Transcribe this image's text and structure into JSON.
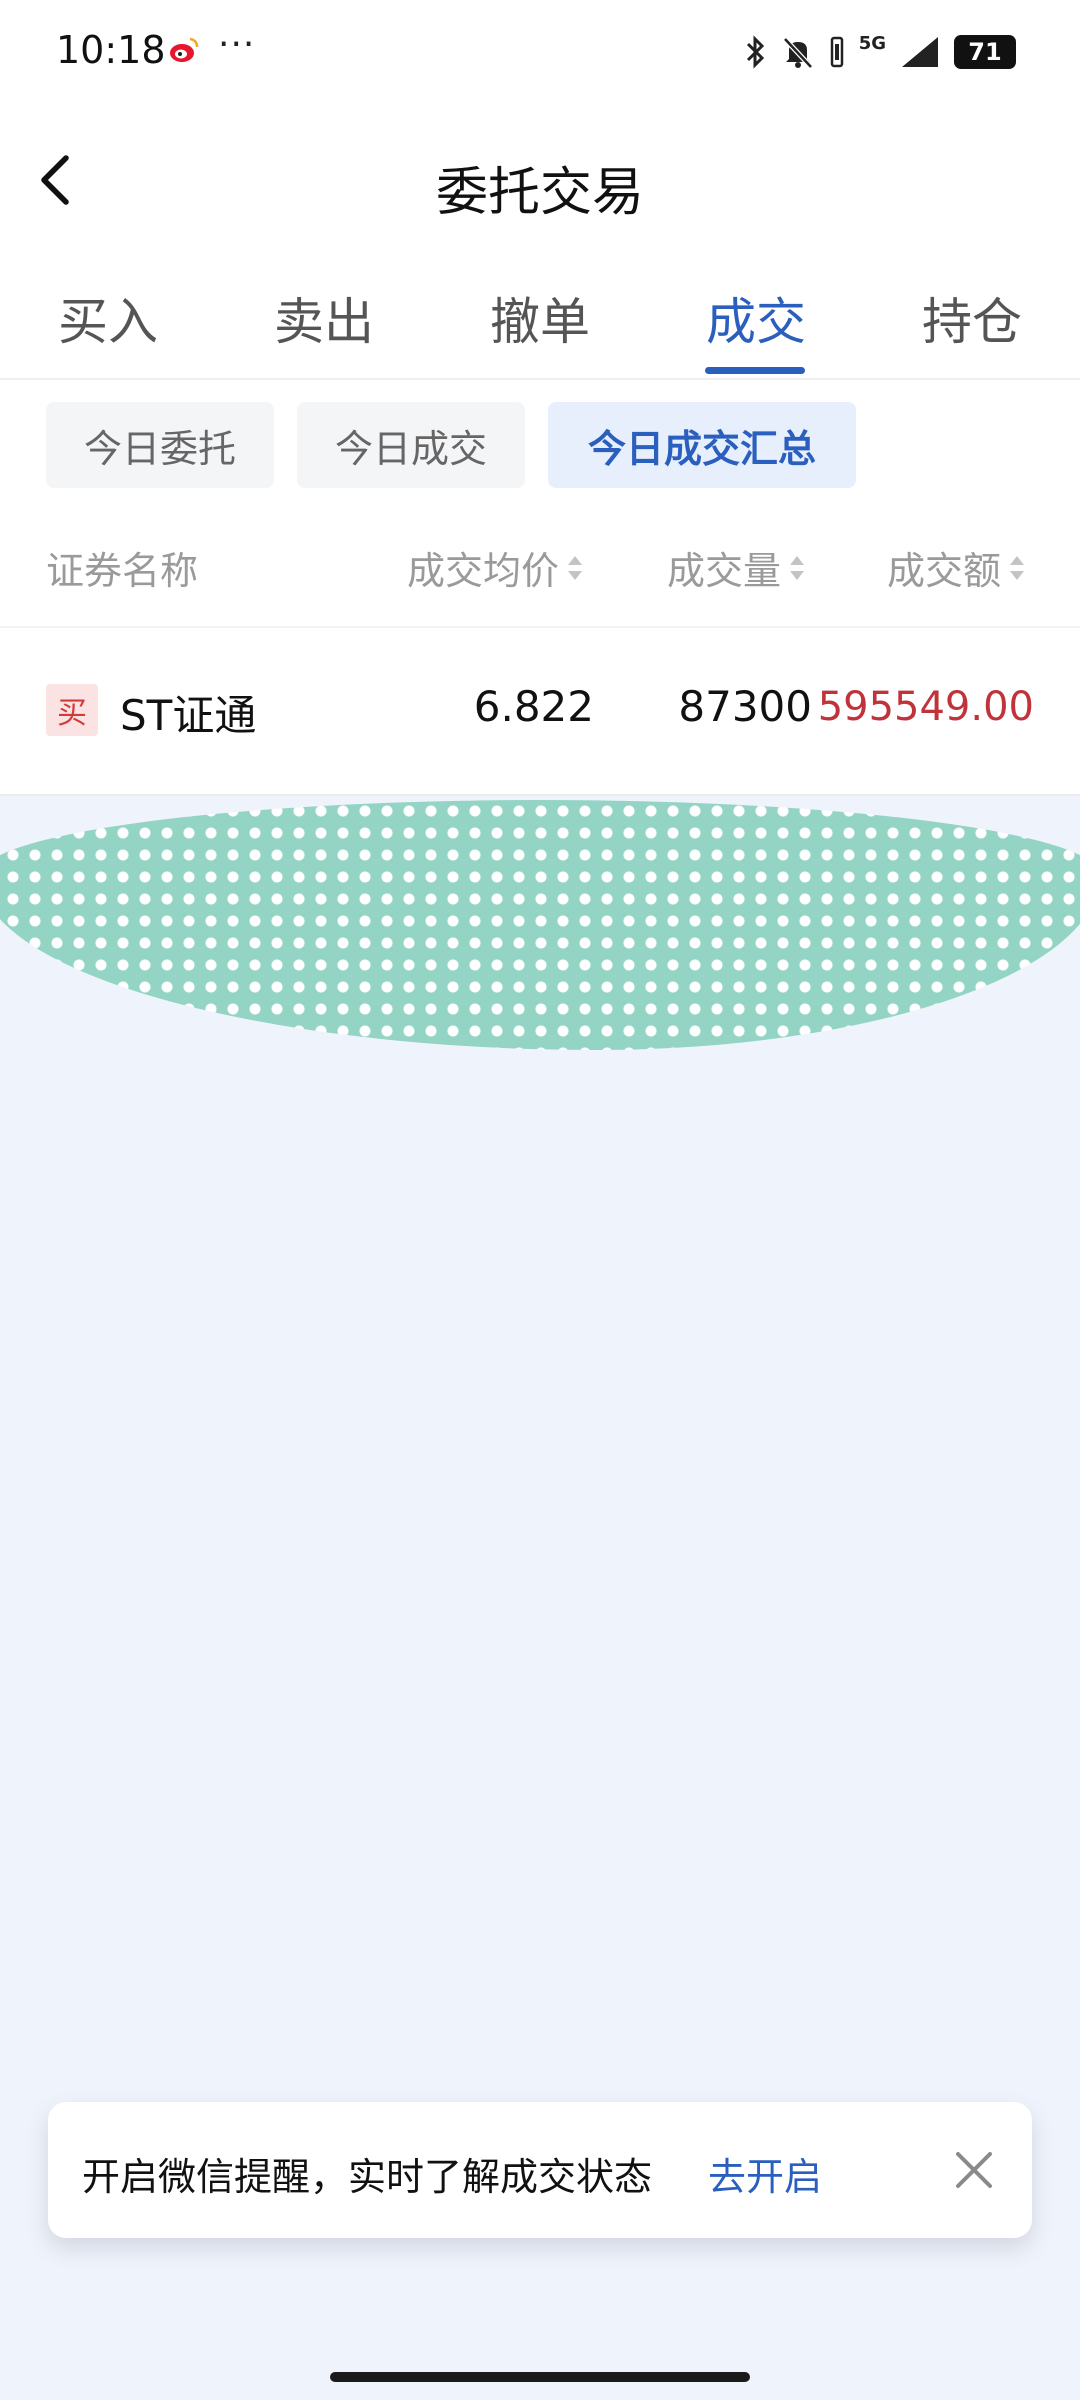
{
  "status_bar": {
    "time": "10:18",
    "more": "···",
    "network": "5G",
    "battery": "71",
    "icons": [
      "weibo-icon",
      "bluetooth-icon",
      "mute-icon",
      "vibrate-icon",
      "signal-icon"
    ]
  },
  "header": {
    "title": "委托交易"
  },
  "tabs": [
    {
      "label": "买入"
    },
    {
      "label": "卖出"
    },
    {
      "label": "撤单"
    },
    {
      "label": "成交",
      "active": true
    },
    {
      "label": "持仓"
    }
  ],
  "sub_tabs": [
    {
      "label": "今日委托"
    },
    {
      "label": "今日成交"
    },
    {
      "label": "今日成交汇总",
      "active": true
    }
  ],
  "table": {
    "columns": [
      "证券名称",
      "成交均价",
      "成交量",
      "成交额"
    ],
    "rows": [
      {
        "badge": "买",
        "name": "ST证通",
        "avg_price": "6.822",
        "volume": "87300",
        "amount": "595549.00"
      }
    ]
  },
  "toast": {
    "message": "开启微信提醒，实时了解成交状态",
    "action": "去开启"
  },
  "colors": {
    "accent": "#2b5fbd",
    "amount_red": "#c0333b",
    "buy_badge_bg": "#fbe3e3",
    "page_bg": "#eff3fc",
    "decor_teal": "#8fd3c3"
  }
}
